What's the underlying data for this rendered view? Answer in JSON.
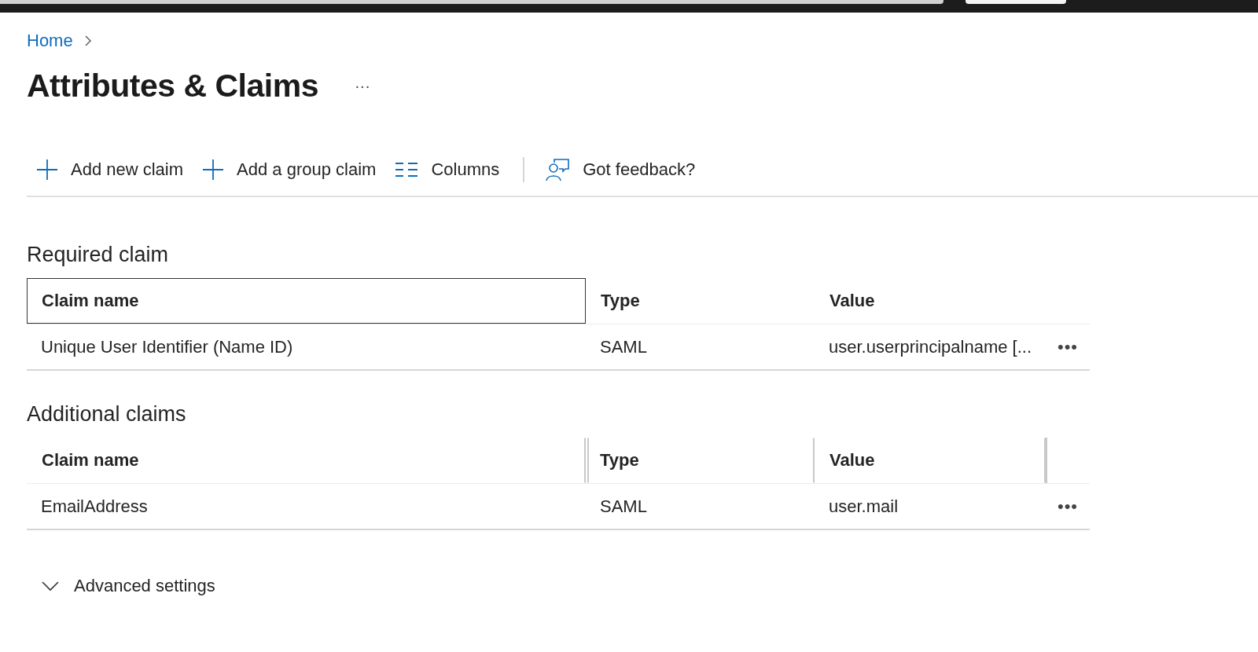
{
  "breadcrumb": {
    "items": [
      "Home"
    ]
  },
  "page": {
    "title": "Attributes & Claims",
    "more": "···"
  },
  "toolbar": [
    {
      "kind": "add",
      "label": "Add new claim"
    },
    {
      "kind": "add",
      "label": "Add a group claim"
    },
    {
      "kind": "columns",
      "label": "Columns"
    },
    {
      "kind": "feedback",
      "label": "Got feedback?"
    }
  ],
  "sections": [
    {
      "title": "Required claim",
      "resizable": false,
      "columns": [
        {
          "label": "Claim name",
          "focused": true
        },
        {
          "label": "Type",
          "focused": false
        },
        {
          "label": "Value",
          "focused": false
        }
      ],
      "rows": [
        {
          "cells": [
            "Unique User Identifier (Name ID)",
            "SAML",
            "user.userprincipalname [..."
          ],
          "more": "•••"
        }
      ]
    },
    {
      "title": "Additional claims",
      "resizable": true,
      "columns": [
        {
          "label": "Claim name",
          "focused": false
        },
        {
          "label": "Type",
          "focused": false
        },
        {
          "label": "Value",
          "focused": false
        }
      ],
      "rows": [
        {
          "cells": [
            "EmailAddress",
            "SAML",
            "user.mail"
          ],
          "more": "•••"
        }
      ]
    }
  ],
  "advanced": {
    "label": "Advanced settings",
    "expanded": false
  }
}
